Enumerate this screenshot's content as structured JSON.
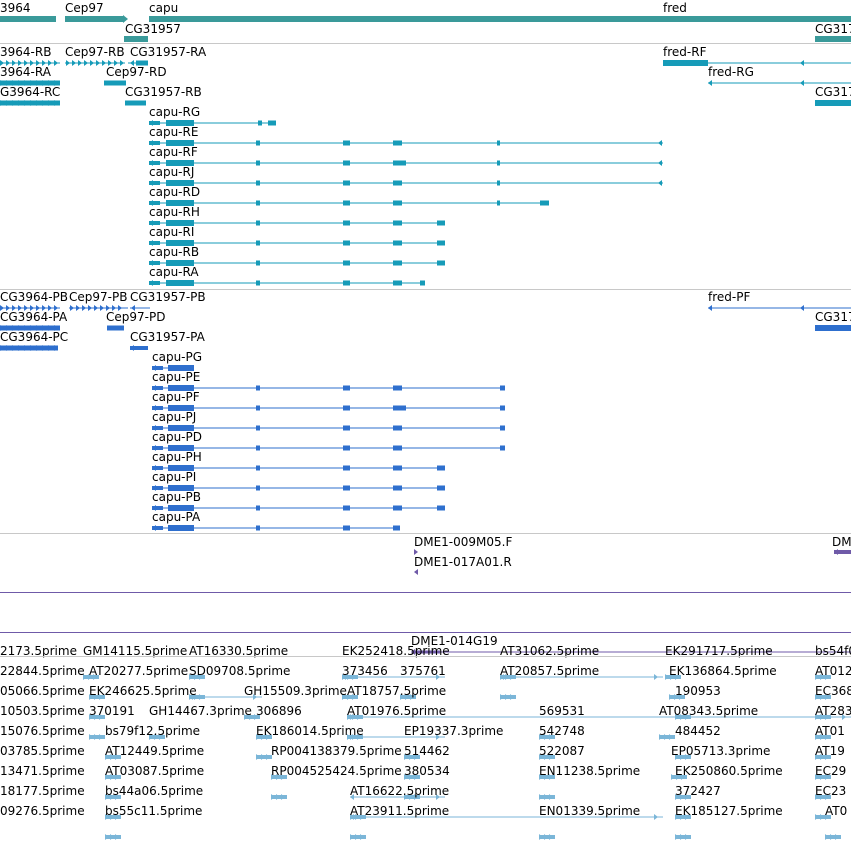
{
  "colors": {
    "gene": "#3a9a9a",
    "transcript": "#169bb8",
    "protein": "#2e6fce",
    "clone": "#6f5aa8",
    "est": "#7bb6d8",
    "text": "#000000",
    "divider": "#c8c8c8"
  },
  "tracks": {
    "gene": {
      "labels": [
        "3964",
        "Cep97",
        "capu",
        "fred",
        "CG31957",
        "CG317"
      ]
    },
    "transcript": {
      "labels": [
        "3964-RB",
        "Cep97-RB",
        "CG31957-RA",
        "fred-RF",
        "3964-RA",
        "Cep97-RD",
        "fred-RG",
        "G3964-RC",
        "CG31957-RB",
        "CG317",
        "capu-RG",
        "capu-RE",
        "capu-RF",
        "capu-RJ",
        "capu-RD",
        "capu-RH",
        "capu-RI",
        "capu-RB",
        "capu-RA"
      ]
    },
    "protein": {
      "labels": [
        "CG3964-PB",
        "Cep97-PB",
        "CG31957-PB",
        "fred-PF",
        "CG3964-PA",
        "Cep97-PD",
        "CG317",
        "CG3964-PC",
        "CG31957-PA",
        "capu-PG",
        "capu-PE",
        "capu-PF",
        "capu-PJ",
        "capu-PD",
        "capu-PH",
        "capu-PI",
        "capu-PB",
        "capu-PA"
      ]
    },
    "clone": {
      "labels": [
        "DME1-009M05.F",
        "DME1-017A01.R",
        "DM",
        "DME1-014G19"
      ]
    },
    "est": {
      "labels": [
        "2173.5prime",
        "GM14115.5prime",
        "AT16330.5prime",
        "EK252418.5prime",
        "AT31062.5prime",
        "EK291717.5prime",
        "bs54f0",
        "22844.5prime",
        "AT20277.5prime",
        "SD09708.5prime",
        "373456",
        "375761",
        "AT20857.5prime",
        "EK136864.5prime",
        "AT012",
        "05066.5prime",
        "EK246625.5prime",
        "GH15509.3prime",
        "AT18757.5prime",
        "190953",
        "EC368",
        "10503.5prime",
        "370191",
        "GH14467.3prime",
        "306896",
        "AT01976.5prime",
        "569531",
        "AT08343.5prime",
        "AT283",
        "15076.5prime",
        "bs79f12.5prime",
        "EK186014.5prime",
        "EP19337.3prime",
        "542748",
        "484452",
        "AT01",
        "03785.5prime",
        "AT12449.5prime",
        "RP004138379.5prime",
        "514462",
        "522087",
        "EP05713.3prime",
        "AT19",
        "13471.5prime",
        "AT03087.5prime",
        "RP004525424.5prime",
        "380534",
        "EN11238.5prime",
        "EK250860.5prime",
        "EC29",
        "18177.5prime",
        "bs44a06.5prime",
        "AT16622.5prime",
        "372427",
        "EC23",
        "09276.5prime",
        "bs55c11.5prime",
        "AT23911.5prime",
        "EN01339.5prime",
        "EK185127.5prime",
        "AT0"
      ]
    }
  }
}
